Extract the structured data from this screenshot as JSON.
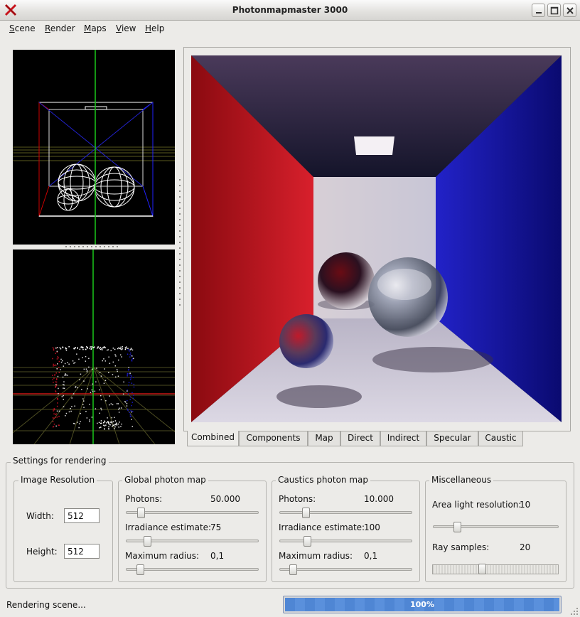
{
  "window": {
    "title": "Photonmapmaster 3000"
  },
  "menu": [
    {
      "label": "Scene",
      "mnemonic": "S",
      "rest": "cene"
    },
    {
      "label": "Render",
      "mnemonic": "R",
      "rest": "ender"
    },
    {
      "label": "Maps",
      "mnemonic": "M",
      "rest": "aps"
    },
    {
      "label": "View",
      "mnemonic": "V",
      "rest": "iew"
    },
    {
      "label": "Help",
      "mnemonic": "H",
      "rest": "elp"
    }
  ],
  "tabs": [
    "Combined",
    "Components",
    "Map",
    "Direct",
    "Indirect",
    "Specular",
    "Caustic"
  ],
  "active_tab": "Combined",
  "settings": {
    "title": "Settings for rendering",
    "image_resolution": {
      "title": "Image Resolution",
      "width_label": "Width:",
      "width_value": "512",
      "height_label": "Height:",
      "height_value": "512"
    },
    "global_photon_map": {
      "title": "Global photon map",
      "photons_label": "Photons:",
      "photons_value": "50.000",
      "irradiance_label": "Irradiance estimate:",
      "irradiance_value": "75",
      "radius_label": "Maximum radius:",
      "radius_value": "0,1"
    },
    "caustics_photon_map": {
      "title": "Caustics photon map",
      "photons_label": "Photons:",
      "photons_value": "10.000",
      "irradiance_label": "Irradiance estimate:",
      "irradiance_value": "100",
      "radius_label": "Maximum radius:",
      "radius_value": "0,1"
    },
    "misc": {
      "title": "Miscellaneous",
      "area_light_label": "Area light resolution:",
      "area_light_value": "10",
      "ray_samples_label": "Ray samples:",
      "ray_samples_value": "20"
    }
  },
  "status": {
    "text": "Rendering scene...",
    "progress_label": "100%",
    "progress": 1.0
  },
  "colors": {
    "wall_left": "#c01020",
    "wall_right": "#1818c0",
    "progress_fill": "#4f86d4"
  }
}
